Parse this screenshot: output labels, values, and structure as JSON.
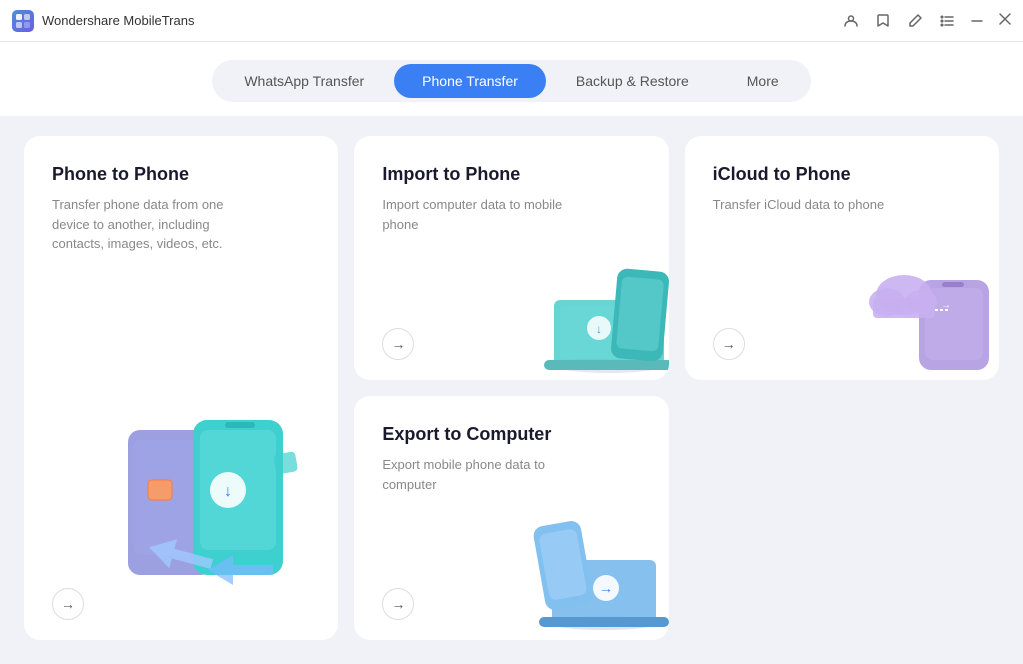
{
  "app": {
    "name": "Wondershare MobileTrans",
    "icon_label": "W"
  },
  "titlebar": {
    "controls": {
      "account_label": "account",
      "bookmark_label": "bookmark",
      "edit_label": "edit",
      "menu_label": "menu",
      "minimize_label": "minimize",
      "close_label": "close"
    }
  },
  "nav": {
    "tabs": [
      {
        "id": "whatsapp",
        "label": "WhatsApp Transfer",
        "active": false
      },
      {
        "id": "phone",
        "label": "Phone Transfer",
        "active": true
      },
      {
        "id": "backup",
        "label": "Backup & Restore",
        "active": false
      },
      {
        "id": "more",
        "label": "More",
        "active": false
      }
    ]
  },
  "cards": {
    "phone_to_phone": {
      "title": "Phone to Phone",
      "description": "Transfer phone data from one device to another, including contacts, images, videos, etc.",
      "arrow": "→"
    },
    "import_to_phone": {
      "title": "Import to Phone",
      "description": "Import computer data to mobile phone",
      "arrow": "→"
    },
    "icloud_to_phone": {
      "title": "iCloud to Phone",
      "description": "Transfer iCloud data to phone",
      "arrow": "→"
    },
    "export_to_computer": {
      "title": "Export to Computer",
      "description": "Export mobile phone data to computer",
      "arrow": "→"
    }
  }
}
